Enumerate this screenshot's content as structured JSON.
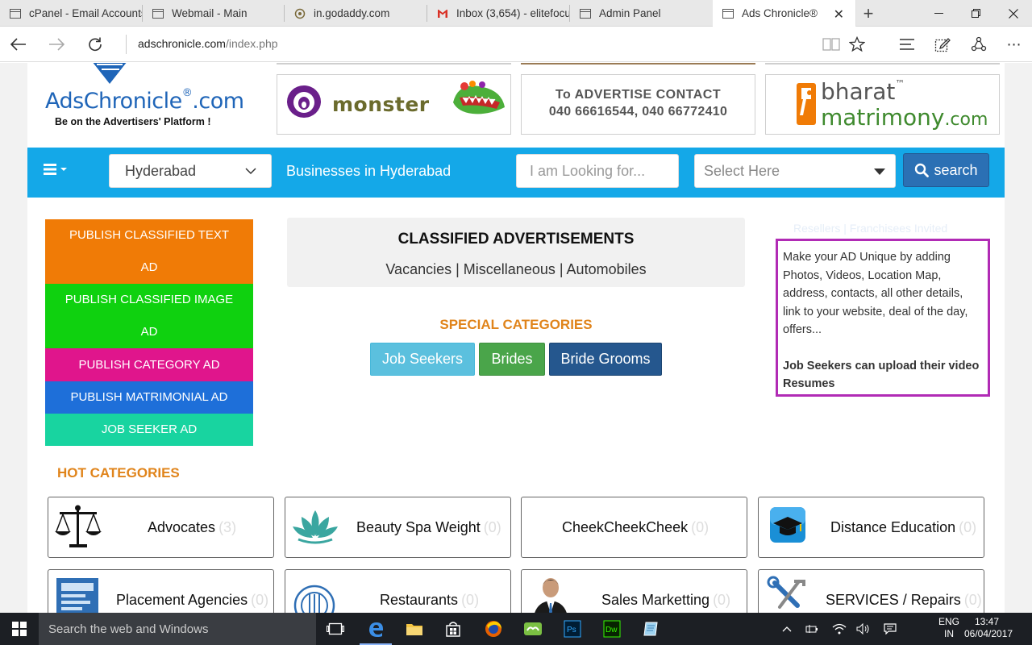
{
  "browser": {
    "tabs": [
      {
        "title": "cPanel - Email Accounts",
        "icon": "page-icon"
      },
      {
        "title": "Webmail - Main",
        "icon": "page-icon"
      },
      {
        "title": "in.godaddy.com",
        "icon": "godaddy-icon"
      },
      {
        "title": "Inbox (3,654) - elitefocu",
        "icon": "gmail-icon"
      },
      {
        "title": "Admin Panel",
        "icon": "page-icon"
      },
      {
        "title": "Ads Chronicle®",
        "icon": "page-icon",
        "active": true
      }
    ],
    "url_domain": "adschronicle.com",
    "url_path": "/index.php"
  },
  "header": {
    "logo_text": "AdsChronicle",
    "logo_reg": "®",
    "logo_suffix": ".com",
    "tagline": "Be on the Advertisers' Platform !",
    "banners": {
      "monster": "monster",
      "contact_line1": "To ADVERTISE  CONTACT",
      "contact_line2": "040 66616544, 040 66772410",
      "bharat_line1": "bharat",
      "bharat_tm": "™",
      "bharat_line2": "matrimony",
      "bharat_com": ".com"
    }
  },
  "searchbar": {
    "city": "Hyderabad",
    "businesses_label": "Businesses in Hyderabad",
    "looking_placeholder": "I am Looking for...",
    "select_placeholder": "Select Here",
    "search_label": "search"
  },
  "publish": [
    {
      "line1": "PUBLISH CLASSIFIED TEXT",
      "line2": "AD",
      "color": "#f07b06"
    },
    {
      "line1": "PUBLISH CLASSIFIED IMAGE",
      "line2": "AD",
      "color": "#0fd10f"
    },
    {
      "line1": "PUBLISH CATEGORY AD",
      "color": "#e0158c"
    },
    {
      "line1": "PUBLISH MATRIMONIAL AD",
      "color": "#1e6fd9"
    },
    {
      "line1": "JOB SEEKER AD",
      "color": "#18d4a0"
    }
  ],
  "classified": {
    "title": "CLASSIFIED ADVERTISEMENTS",
    "links": [
      "Vacancies",
      "Miscellaneous",
      "Automobiles"
    ],
    "separator": " | "
  },
  "special": {
    "title": "SPECIAL CATEGORIES",
    "buttons": [
      {
        "label": "Job Seekers",
        "color": "#5bc0de"
      },
      {
        "label": "Brides",
        "color": "#4aa54a"
      },
      {
        "label": "Bride Grooms",
        "color": "#25578e"
      }
    ]
  },
  "info": {
    "reseller": "Resellers | Franchisees Invited",
    "text": "Make your AD Unique by adding Photos, Videos, Location Map, address, contacts, all other details, link to your website, deal of the day, offers...",
    "bold": "Job Seekers can upload their video Resumes"
  },
  "hot": {
    "title": "HOT CATEGORIES",
    "categories": [
      {
        "name": "Advocates",
        "count": "(3)",
        "icon": "scales-icon"
      },
      {
        "name": "Beauty Spa Weight",
        "count": "(0)",
        "icon": "lotus-icon"
      },
      {
        "name": "CheekCheekCheek",
        "count": "(0)",
        "icon": ""
      },
      {
        "name": "Distance Education",
        "count": "(0)",
        "icon": "graduation-cap-icon"
      },
      {
        "name": "Placement Agencies",
        "count": "(0)",
        "icon": "document-icon"
      },
      {
        "name": "Restaurants",
        "count": "(0)",
        "icon": "plate-icon"
      },
      {
        "name": "Sales Marketting",
        "count": "(0)",
        "icon": "businessman-icon"
      },
      {
        "name": "SERVICES / Repairs",
        "count": "(0)",
        "icon": "tools-icon"
      }
    ]
  },
  "taskbar": {
    "search_placeholder": "Search the web and Windows",
    "lang_line1": "ENG",
    "lang_line2": "IN",
    "time": "13:47",
    "date": "06/04/2017"
  }
}
